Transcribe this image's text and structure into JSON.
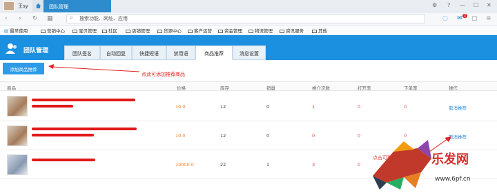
{
  "browser": {
    "user_name": "王sy",
    "tab_title": "团队管理",
    "search_placeholder": "搜索功能、网址、应用",
    "badge_count": "2"
  },
  "bookmarks": [
    "最常使用",
    "营销中心",
    "宝贝管理",
    "社区",
    "店铺管理",
    "货源中心",
    "客户运营",
    "资金管理",
    "物流管理",
    "资讯服务",
    "其他"
  ],
  "app": {
    "title": "团队管理",
    "tabs": [
      {
        "label": "团队签名",
        "active": false
      },
      {
        "label": "自动回复",
        "active": false
      },
      {
        "label": "快捷短语",
        "active": false
      },
      {
        "label": "禁用语",
        "active": false
      },
      {
        "label": "商品推荐",
        "active": true
      },
      {
        "label": "消息设置",
        "active": false
      }
    ],
    "add_button": "添加商品推荐",
    "hint": "点此可添加推荐商品",
    "row_hint": "点击可取消推荐"
  },
  "table": {
    "headers": [
      "商品",
      "价格",
      "库存",
      "销量",
      "推介次数",
      "打开率",
      "下单率",
      "操作"
    ],
    "rows": [
      {
        "price": "10.0",
        "stock": "12",
        "sales": "0",
        "rec": "1",
        "open": "0",
        "order": "0",
        "action": "取消推荐"
      },
      {
        "price": "10.0",
        "stock": "12",
        "sales": "0",
        "rec": "0",
        "open": "0",
        "order": "0",
        "action": "取消推荐"
      },
      {
        "price": "10000.0",
        "stock": "22",
        "sales": "1",
        "rec": "3",
        "open": "0",
        "order": "",
        "action": ""
      }
    ]
  },
  "watermark": {
    "brand": "乐发网",
    "url": "www.6pf.cn"
  }
}
